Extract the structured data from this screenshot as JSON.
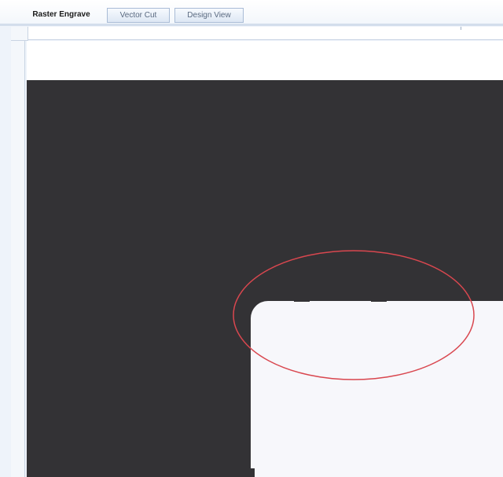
{
  "tabs": [
    {
      "label": "Raster Engrave",
      "active": true
    },
    {
      "label": "Vector Cut",
      "active": false
    },
    {
      "label": "Design View",
      "active": false
    }
  ],
  "colors": {
    "engrave_fill": "#333235",
    "cut_shape": "#f7f7fb",
    "highlight_ellipse": "#d9474f"
  }
}
